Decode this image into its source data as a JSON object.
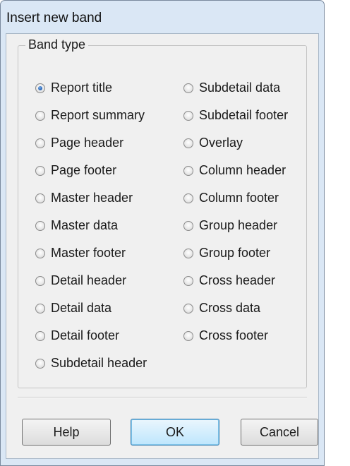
{
  "window": {
    "title": "Insert new band"
  },
  "band_type": {
    "legend": "Band type",
    "selected": "Report title",
    "options": [
      "Report title",
      "Subdetail data",
      "Report summary",
      "Subdetail footer",
      "Page header",
      "Overlay",
      "Page footer",
      "Column header",
      "Master header",
      "Column footer",
      "Master data",
      "Group header",
      "Master footer",
      "Group footer",
      "Detail header",
      "Cross header",
      "Detail data",
      "Cross data",
      "Detail footer",
      "Cross footer",
      "Subdetail header"
    ]
  },
  "buttons": {
    "help": "Help",
    "ok": "OK",
    "cancel": "Cancel"
  },
  "colors": {
    "window_frame": "#dae7f5",
    "client": "#f0f0f0",
    "radio_selected": "#1f5fb3",
    "default_button_border": "#3c7fb1"
  }
}
